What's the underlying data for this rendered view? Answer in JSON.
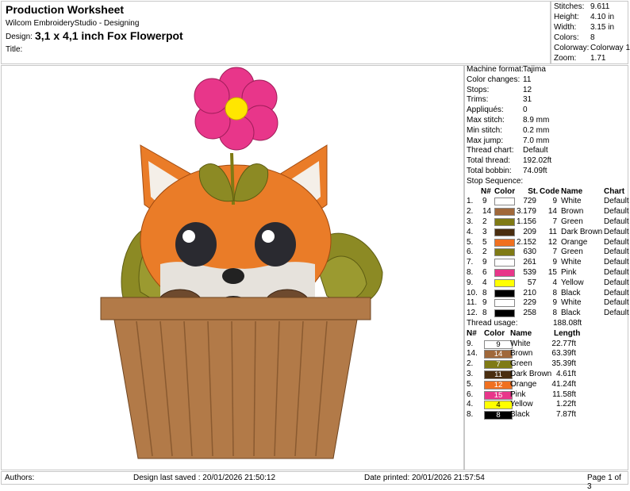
{
  "header": {
    "title": "Production Worksheet",
    "subtitle": "Wilcom EmbroideryStudio - Designing",
    "design_label": "Design:",
    "design_value": "3,1 x 4,1 inch Fox Flowerpot",
    "title_label": "Title:"
  },
  "stats": [
    {
      "k": "Stitches:",
      "v": "9.611"
    },
    {
      "k": "Height:",
      "v": "4.10 in"
    },
    {
      "k": "Width:",
      "v": "3.15 in"
    },
    {
      "k": "Colors:",
      "v": "8"
    },
    {
      "k": "Colorway:",
      "v": "Colorway 1"
    },
    {
      "k": "Zoom:",
      "v": "1.71"
    }
  ],
  "machine": [
    {
      "k": "Machine format:",
      "v": "Tajima"
    },
    {
      "k": "Color changes:",
      "v": "11"
    },
    {
      "k": "Stops:",
      "v": "12"
    },
    {
      "k": "Trims:",
      "v": "31"
    },
    {
      "k": "Appliqués:",
      "v": "0"
    },
    {
      "k": "Max stitch:",
      "v": "8.9 mm"
    },
    {
      "k": "Min stitch:",
      "v": "0.2 mm"
    },
    {
      "k": "Max jump:",
      "v": "7.0 mm"
    },
    {
      "k": "Thread chart:",
      "v": "Default"
    },
    {
      "k": "Total thread:",
      "v": "192.02ft"
    },
    {
      "k": "Total bobbin:",
      "v": "74.09ft"
    }
  ],
  "stop_title": "Stop Sequence:",
  "stop_headers": {
    "n": "N#",
    "color": "Color",
    "st": "St.",
    "code": "Code",
    "name": "Name",
    "chart": "Chart"
  },
  "stops": [
    {
      "i": "1.",
      "n": "9",
      "hex": "#ffffff",
      "st": "729",
      "code": "9",
      "name": "White",
      "chart": "Default"
    },
    {
      "i": "2.",
      "n": "14",
      "hex": "#a0683a",
      "st": "3.179",
      "code": "14",
      "name": "Brown",
      "chart": "Default"
    },
    {
      "i": "3.",
      "n": "2",
      "hex": "#7f7a14",
      "st": "1.156",
      "code": "7",
      "name": "Green",
      "chart": "Default"
    },
    {
      "i": "4.",
      "n": "3",
      "hex": "#4a2e10",
      "st": "209",
      "code": "11",
      "name": "Dark Brown",
      "chart": "Default"
    },
    {
      "i": "5.",
      "n": "5",
      "hex": "#f07020",
      "st": "2.152",
      "code": "12",
      "name": "Orange",
      "chart": "Default"
    },
    {
      "i": "6.",
      "n": "2",
      "hex": "#7f7a14",
      "st": "630",
      "code": "7",
      "name": "Green",
      "chart": "Default"
    },
    {
      "i": "7.",
      "n": "9",
      "hex": "#ffffff",
      "st": "261",
      "code": "9",
      "name": "White",
      "chart": "Default"
    },
    {
      "i": "8.",
      "n": "6",
      "hex": "#e8368a",
      "st": "539",
      "code": "15",
      "name": "Pink",
      "chart": "Default"
    },
    {
      "i": "9.",
      "n": "4",
      "hex": "#ffff00",
      "st": "57",
      "code": "4",
      "name": "Yellow",
      "chart": "Default"
    },
    {
      "i": "10.",
      "n": "8",
      "hex": "#000000",
      "st": "210",
      "code": "8",
      "name": "Black",
      "chart": "Default"
    },
    {
      "i": "11.",
      "n": "9",
      "hex": "#ffffff",
      "st": "229",
      "code": "9",
      "name": "White",
      "chart": "Default"
    },
    {
      "i": "12.",
      "n": "8",
      "hex": "#000000",
      "st": "258",
      "code": "8",
      "name": "Black",
      "chart": "Default"
    }
  ],
  "usage_title": "Thread usage:",
  "usage_total": "188.08ft",
  "usage_headers": {
    "n": "N#",
    "color": "Color",
    "name": "Name",
    "length": "Length"
  },
  "usage": [
    {
      "i": "9.",
      "code": "9",
      "hex": "#ffffff",
      "fg": "#000000",
      "name": "White",
      "len": "22.77ft"
    },
    {
      "i": "14.",
      "code": "14",
      "hex": "#a0683a",
      "fg": "#ffffff",
      "name": "Brown",
      "len": "63.39ft"
    },
    {
      "i": "2.",
      "code": "7",
      "hex": "#7f7a14",
      "fg": "#ffffff",
      "name": "Green",
      "len": "35.39ft"
    },
    {
      "i": "3.",
      "code": "11",
      "hex": "#4a2e10",
      "fg": "#ffffff",
      "name": "Dark Brown",
      "len": "4.61ft"
    },
    {
      "i": "5.",
      "code": "12",
      "hex": "#f07020",
      "fg": "#ffffff",
      "name": "Orange",
      "len": "41.24ft"
    },
    {
      "i": "6.",
      "code": "15",
      "hex": "#e8368a",
      "fg": "#ffffff",
      "name": "Pink",
      "len": "11.58ft"
    },
    {
      "i": "4.",
      "code": "4",
      "hex": "#ffff00",
      "fg": "#000000",
      "name": "Yellow",
      "len": "1.22ft"
    },
    {
      "i": "8.",
      "code": "8",
      "hex": "#000000",
      "fg": "#ffffff",
      "name": "Black",
      "len": "7.87ft"
    }
  ],
  "footer": {
    "authors": "Authors:",
    "saved": "Design last saved : 20/01/2026 21:50:12",
    "printed": "Date printed: 20/01/2026 21:57:54",
    "page": "Page 1 of 3"
  }
}
